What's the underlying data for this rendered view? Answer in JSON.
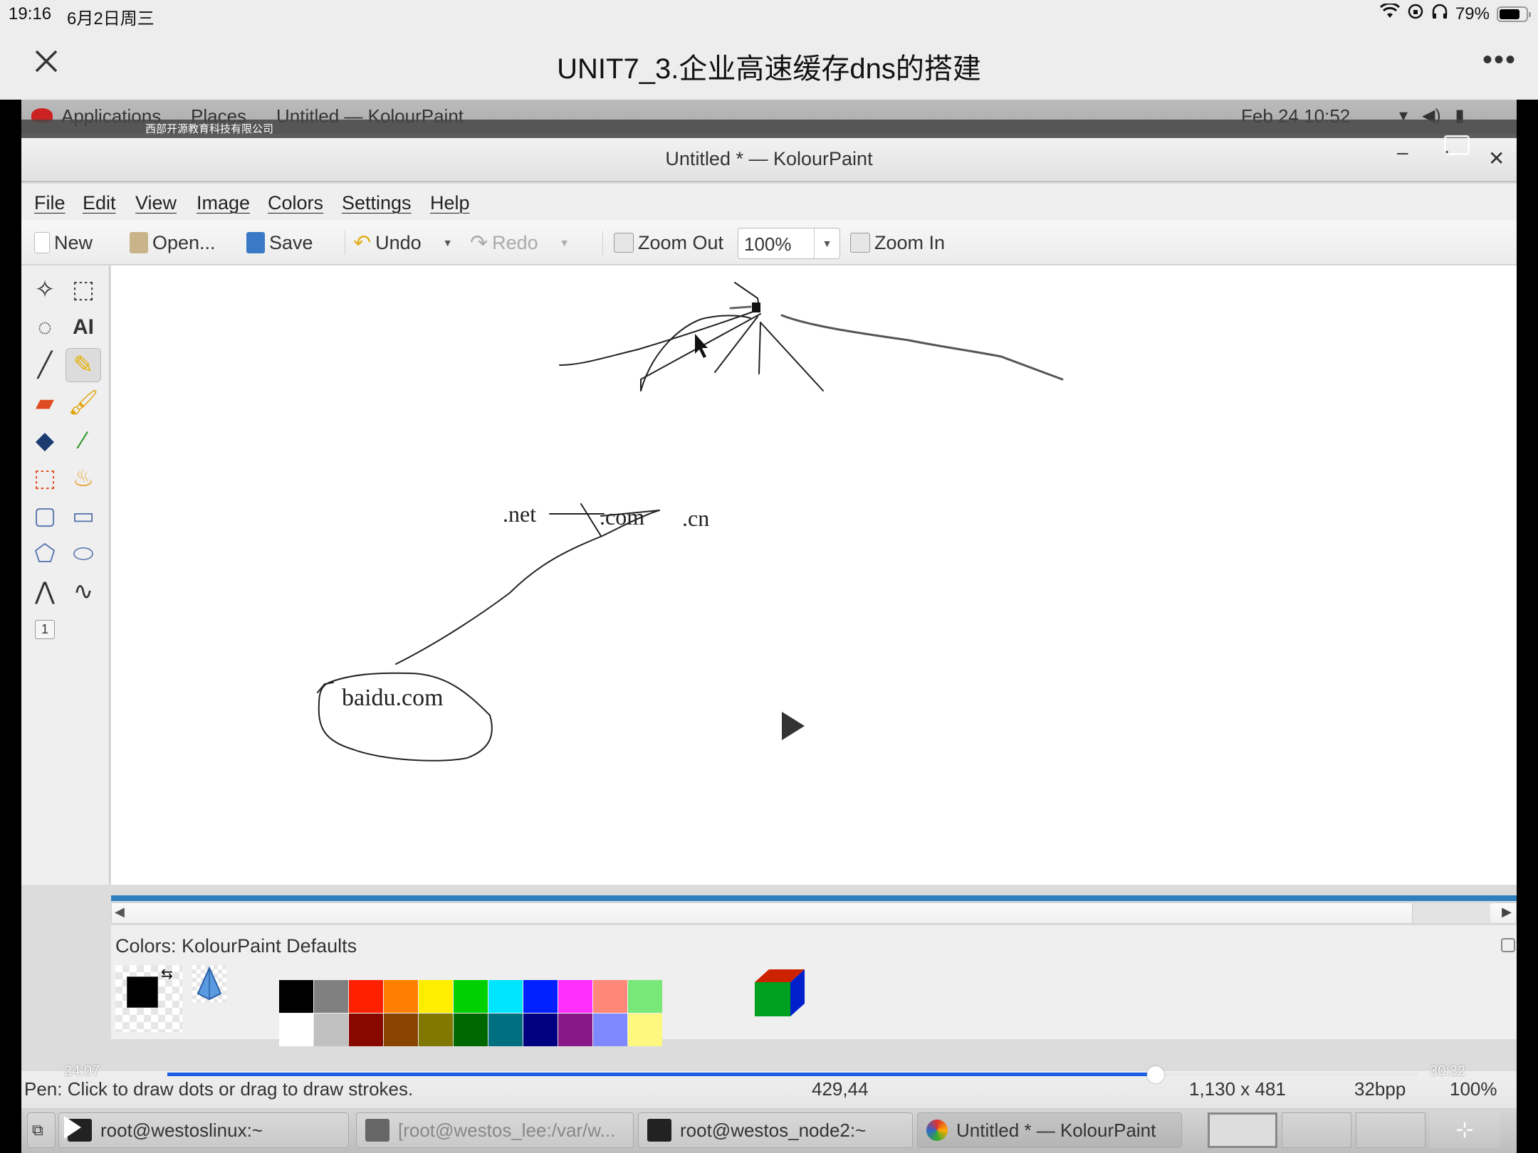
{
  "ios_status": {
    "time": "19:16",
    "date": "6月2日周三",
    "battery": "79%",
    "battery_level": 0.79,
    "icons": [
      "wifi-icon",
      "rotation-lock-icon",
      "headphones-icon",
      "battery-icon"
    ]
  },
  "video_header": {
    "title": "UNIT7_3.企业高速缓存dns的搭建",
    "close_icon": "close-icon",
    "more_icon": "more-icon"
  },
  "gnome_bar": {
    "applications": "Applications",
    "places": "Places",
    "active_window": "Untitled — KolourPaint",
    "clock": "Feb 24  10:52",
    "watermark": "西部开源教育科技有限公司"
  },
  "window": {
    "title": "Untitled * — KolourPaint",
    "minimize": "–",
    "maximize": "▪",
    "close": "✕"
  },
  "menu": [
    "File",
    "Edit",
    "View",
    "Image",
    "Colors",
    "Settings",
    "Help"
  ],
  "toolbar": {
    "new": "New",
    "open": "Open...",
    "save": "Save",
    "undo": "Undo",
    "redo": "Redo",
    "zoom_out": "Zoom Out",
    "zoom_value": "100%",
    "zoom_in": "Zoom In"
  },
  "tools": [
    {
      "name": "free-form-selection",
      "icon": "lasso-icon"
    },
    {
      "name": "rectangular-selection",
      "icon": "rect-select-icon"
    },
    {
      "name": "elliptical-selection",
      "icon": "ellipse-select-icon"
    },
    {
      "name": "text",
      "icon": "text-icon"
    },
    {
      "name": "line",
      "icon": "line-icon"
    },
    {
      "name": "pen",
      "icon": "pencil-icon",
      "selected": true
    },
    {
      "name": "eraser",
      "icon": "eraser-icon"
    },
    {
      "name": "brush",
      "icon": "brush-icon"
    },
    {
      "name": "flood-fill",
      "icon": "fill-icon"
    },
    {
      "name": "color-picker",
      "icon": "picker-icon"
    },
    {
      "name": "color-eraser",
      "icon": "color-eraser-icon"
    },
    {
      "name": "spraycan",
      "icon": "spraycan-icon"
    },
    {
      "name": "rounded-rectangle",
      "icon": "rounded-rect-icon"
    },
    {
      "name": "rectangle",
      "icon": "rect-icon"
    },
    {
      "name": "polygon",
      "icon": "polygon-icon"
    },
    {
      "name": "ellipse",
      "icon": "ellipse-icon"
    },
    {
      "name": "connected-lines",
      "icon": "polyline-icon"
    },
    {
      "name": "curve",
      "icon": "curve-icon"
    },
    {
      "name": "pen-width",
      "icon": "width-1-icon"
    }
  ],
  "canvas": {
    "labels": [
      ".net",
      ".com",
      ".cn",
      "baidu.com"
    ]
  },
  "color_box": {
    "label": "Colors: KolourPaint Defaults",
    "foreground": "#000000",
    "background": "#ffffff",
    "row1": [
      "#000000",
      "#808080",
      "#ff2000",
      "#ff8000",
      "#ffee00",
      "#00d000",
      "#00e5ff",
      "#0020ff",
      "#ff30ff",
      "#ff8878",
      "#78e878"
    ],
    "row2": [
      "#ffffff",
      "#c0c0c0",
      "#880800",
      "#884400",
      "#807800",
      "#006800",
      "#007080",
      "#000080",
      "#881888",
      "#8088ff",
      "#fff880"
    ]
  },
  "statusbar": {
    "message": "Pen: Click to draw dots or drag to draw strokes.",
    "coords": "429,44",
    "size": "1,130 x 481",
    "depth": "32bpp",
    "zoom": "100%"
  },
  "video": {
    "current_time": "24:07",
    "total_time": "30:32",
    "progress": 0.79
  },
  "taskbar": {
    "tasks": [
      {
        "label": "root@westoslinux:~",
        "dim": false
      },
      {
        "label": "[root@westos_lee:/var/w...",
        "dim": true
      },
      {
        "label": "root@westos_node2:~",
        "dim": false
      },
      {
        "label": "Untitled * — KolourPaint",
        "dim": false
      }
    ]
  }
}
